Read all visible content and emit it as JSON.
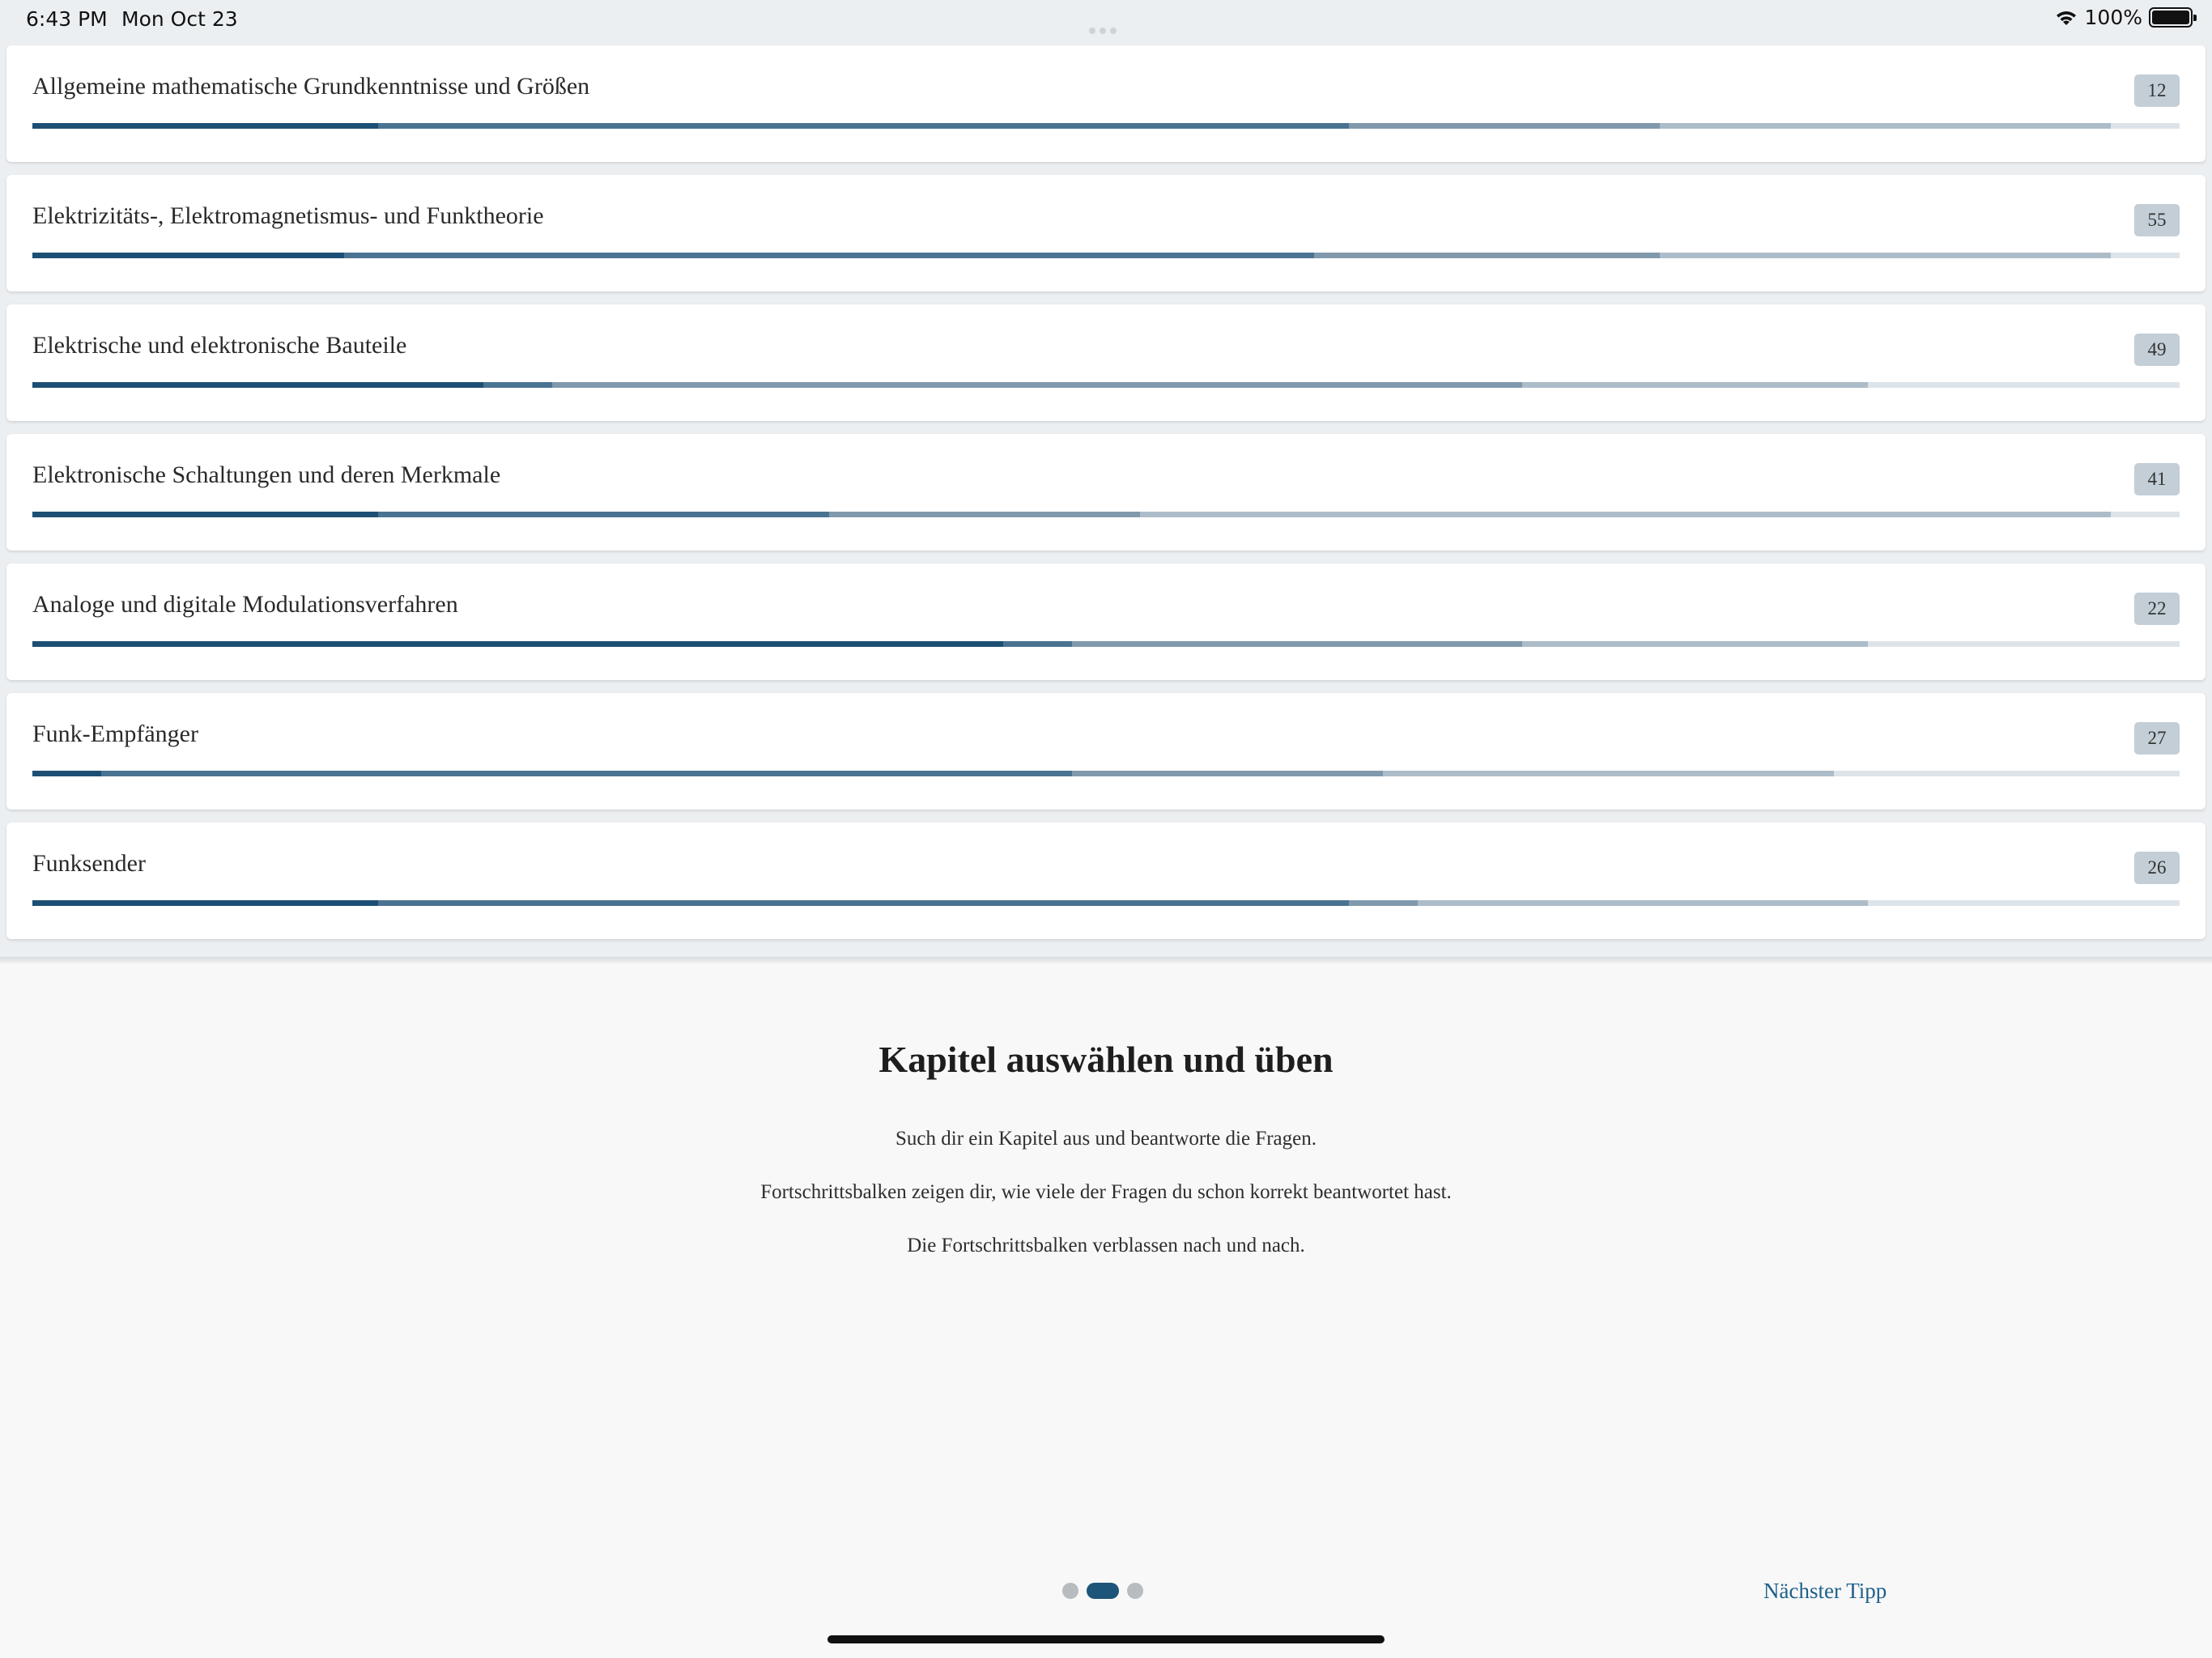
{
  "status_bar": {
    "time": "6:43 PM",
    "date": "Mon Oct 23",
    "battery": "100%",
    "wifi_icon": "wifi-icon",
    "battery_icon": "battery-icon"
  },
  "colors": {
    "level_1": "#1d4f75",
    "level_2": "#4a7392",
    "level_3": "#8199ac",
    "level_4": "#acbcc9",
    "level_5": "#dde4e9",
    "accent": "#1d5f8a"
  },
  "chapters": [
    {
      "title": "Allgemeine mathematische Grundkenntnisse und Größen",
      "count": "12",
      "progress": [
        0.161,
        0.452,
        0.145,
        0.21,
        0.032
      ]
    },
    {
      "title": "Elektrizitäts-, Elektromagnetismus- und Funktheorie",
      "count": "55",
      "progress": [
        0.145,
        0.452,
        0.161,
        0.21,
        0.032
      ]
    },
    {
      "title": "Elektrische und elektronische Bauteile",
      "count": "49",
      "progress": [
        0.21,
        0.032,
        0.452,
        0.161,
        0.145
      ]
    },
    {
      "title": "Elektronische Schaltungen und deren Merkmale",
      "count": "41",
      "progress": [
        0.161,
        0.21,
        0.145,
        0.452,
        0.032
      ]
    },
    {
      "title": "Analoge und digitale Modulationsverfahren",
      "count": "22",
      "progress": [
        0.452,
        0.032,
        0.21,
        0.161,
        0.145
      ]
    },
    {
      "title": "Funk-Empfänger",
      "count": "27",
      "progress": [
        0.032,
        0.452,
        0.145,
        0.21,
        0.161
      ]
    },
    {
      "title": "Funksender",
      "count": "26",
      "progress": [
        0.161,
        0.452,
        0.032,
        0.21,
        0.145
      ]
    }
  ],
  "tip": {
    "title": "Kapitel auswählen und üben",
    "lines": [
      "Such dir ein Kapitel aus und beantworte die Fragen.",
      "Fortschrittsbalken zeigen dir, wie viele der Fragen du schon korrekt beantwortet hast.",
      "Die Fortschrittsbalken verblassen nach und nach."
    ],
    "page_count": 3,
    "current_page": 2,
    "next_label": "Nächster Tipp"
  }
}
